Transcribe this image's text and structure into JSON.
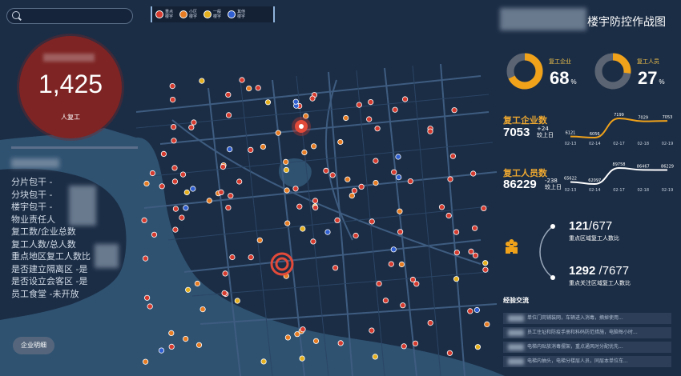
{
  "search": {
    "placeholder": ""
  },
  "legend": {
    "items": [
      {
        "icon": "building-icon",
        "color": "#d63b2f",
        "label": "重点楼宇"
      },
      {
        "icon": "building-icon",
        "color": "#e67d24",
        "label": "小区楼宇"
      },
      {
        "icon": "building-icon",
        "color": "#e4b020",
        "label": "一般楼宇"
      },
      {
        "icon": "building-icon",
        "color": "#2f5fd0",
        "label": "其他楼宇"
      }
    ]
  },
  "summary": {
    "value": "1,425",
    "label": "人复工"
  },
  "info": {
    "rows": [
      "分片包干 -",
      "分块包干 -",
      "楼宇包干 -",
      "物业责任人",
      "复工数/企业总数",
      "复工人数/总人数",
      "重点地区复工人数比",
      "是否建立隔离区 -是",
      "是否设立会客区 -是",
      "员工食堂 -未开放"
    ],
    "company_button": "企业明细"
  },
  "header": {
    "title": "楼宇防控作战图"
  },
  "donuts": [
    {
      "label": "复工企业",
      "value": "68",
      "unit": "%",
      "ratio": 0.68,
      "color": "#f0a21a"
    },
    {
      "label": "复工人员",
      "value": "27",
      "unit": "%",
      "ratio": 0.27,
      "color": "#f0a21a"
    }
  ],
  "kpis": [
    {
      "title": "复工企业数",
      "value": "7053",
      "delta": "+24",
      "delta_label": "较上日"
    },
    {
      "title": "复工人员数",
      "value": "86229",
      "delta": "-238",
      "delta_label": "较上日"
    }
  ],
  "chart_data": [
    {
      "type": "line",
      "title": "复工企业数",
      "categories": [
        "02-13",
        "02-14",
        "02-17",
        "02-18",
        "02-19"
      ],
      "series": [
        {
          "values": [
            6121,
            6056,
            7199,
            7029,
            7053
          ]
        }
      ],
      "color": "#f0a21a"
    },
    {
      "type": "line",
      "title": "复工人员数",
      "categories": [
        "02-13",
        "02-14",
        "02-17",
        "02-18",
        "02-19"
      ],
      "series": [
        {
          "values": [
            65622,
            62097,
            89758,
            86467,
            86229
          ]
        }
      ],
      "color": "#ffffff"
    }
  ],
  "ratios": [
    {
      "value": "121",
      "total": "/677",
      "label": "重点区域复工人数比"
    },
    {
      "value": "1292",
      "total": " /7677",
      "label": "重点关注区域复工人数比"
    }
  ],
  "exchange": {
    "title": "经验交流",
    "rows": [
      "单位门岗铺装网，车辆进入消毒，摘掉使用...",
      "员工住址和防疫手册和科码防范措施，电脑每小时...",
      "电梯内贴放消毒摆架，重点通风时分配优先...",
      "电梯内抽头，电梯分楼层人员，同层本单位车..."
    ]
  },
  "colors": {
    "red": "#d63b2f",
    "orange": "#e67d24",
    "yellow": "#e4b020",
    "blue": "#2f5fd0",
    "water": "#2b4d6e"
  }
}
